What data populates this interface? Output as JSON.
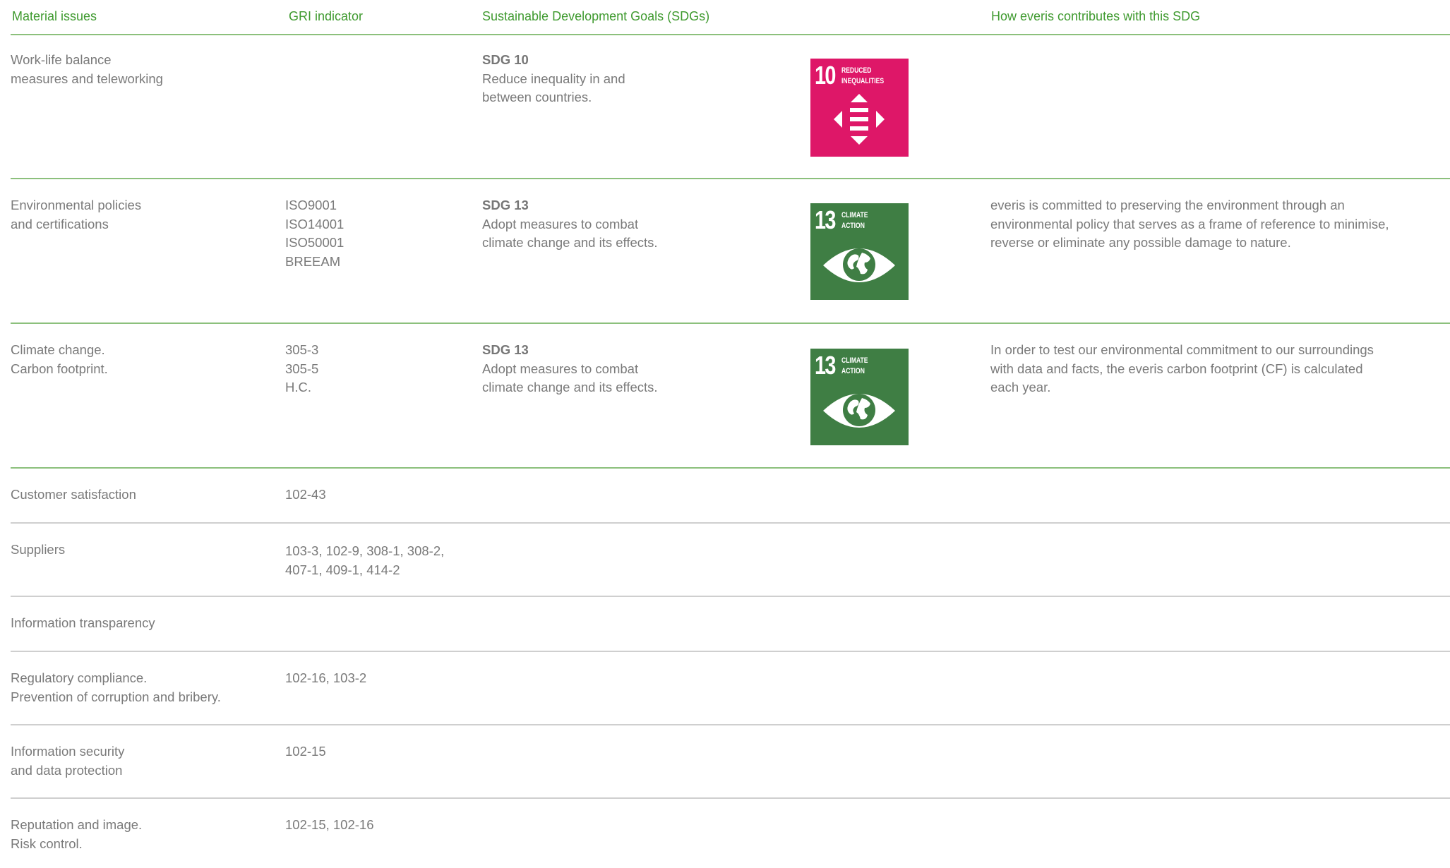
{
  "header": {
    "col_material": "Material issues",
    "col_gri": "GRI indicator",
    "col_sdg": "Sustainable Development Goals (SDGs)",
    "col_contrib": "How everis contributes with this SDG"
  },
  "colors": {
    "header_text": "#3f9a2f",
    "rule_green": "#8cc07c",
    "rule_grey": "#cfcfcf",
    "sdg10": "#de1768",
    "sdg13": "#3f7e44"
  },
  "rows": [
    {
      "issue": [
        "Work-life balance",
        "measures and teleworking"
      ],
      "gri": [],
      "sdg_code": "SDG 10",
      "sdg_desc": [
        "Reduce inequality in and",
        "between countries."
      ],
      "tile": {
        "number": "10",
        "caption": [
          "REDUCED",
          "INEQUALITIES"
        ],
        "icon": "reduced-inequalities-icon"
      },
      "contrib": []
    },
    {
      "issue": [
        "Environmental policies",
        "and certifications"
      ],
      "gri": [
        "ISO9001",
        "ISO14001",
        "ISO50001",
        "BREEAM"
      ],
      "sdg_code": "SDG 13",
      "sdg_desc": [
        "Adopt measures to combat",
        "climate change and its effects."
      ],
      "tile": {
        "number": "13",
        "caption": [
          "CLIMATE",
          "ACTION"
        ],
        "icon": "climate-action-eye-icon"
      },
      "contrib": [
        "everis is committed to preserving the environment through an",
        "environmental policy that serves as a frame of reference to minimise,",
        "reverse or eliminate any possible damage to nature."
      ]
    },
    {
      "issue": [
        "Climate change.",
        "Carbon footprint."
      ],
      "gri": [
        "305-3",
        "305-5",
        "H.C."
      ],
      "sdg_code": "SDG 13",
      "sdg_desc": [
        "Adopt measures to combat",
        "climate change and its effects."
      ],
      "tile": {
        "number": "13",
        "caption": [
          "CLIMATE",
          "ACTION"
        ],
        "icon": "climate-action-eye-icon"
      },
      "contrib": [
        "In order to test our environmental commitment to our surroundings",
        "with data and facts, the everis carbon footprint (CF) is calculated",
        "each year."
      ]
    },
    {
      "issue": [
        "Customer satisfaction"
      ],
      "gri": [
        "102-43"
      ]
    },
    {
      "issue": [
        "Suppliers"
      ],
      "gri": [
        "103-3, 102-9, 308-1, 308-2,",
        "407-1, 409-1, 414-2"
      ]
    },
    {
      "issue": [
        "Information transparency"
      ],
      "gri": []
    },
    {
      "issue": [
        "Regulatory compliance.",
        "Prevention of corruption and bribery."
      ],
      "gri": [
        "102-16, 103-2"
      ]
    },
    {
      "issue": [
        "Information security",
        "and data protection"
      ],
      "gri": [
        "102-15"
      ]
    },
    {
      "issue": [
        "Reputation and image.",
        "Risk control."
      ],
      "gri": [
        "102-15, 102-16"
      ]
    }
  ]
}
